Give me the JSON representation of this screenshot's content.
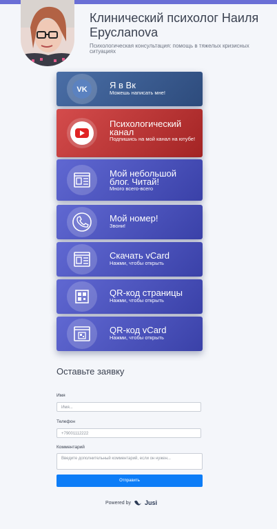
{
  "header": {
    "name": "Клинический психолог Наиля Еруслanova",
    "subtitle": "Психологическая консультация: помощь в тяжелых кризисных ситуациях"
  },
  "cards": [
    {
      "title": "Я в Вк",
      "subtitle": "Можешь написать мне!",
      "icon": "vk-icon",
      "color": "#3d5f95"
    },
    {
      "title": "Психологический канал",
      "subtitle": "Подпишись на мой канал на ютубе!",
      "icon": "youtube-icon",
      "color": "#c43a3a"
    },
    {
      "title": "Мой небольшой блог. Читай!",
      "subtitle": "Много всего-всего",
      "icon": "webpage-icon",
      "color": "#4b54c2"
    },
    {
      "title": "Мой номер!",
      "subtitle": "Звони!",
      "icon": "phone-icon",
      "color": "#4b54c2"
    },
    {
      "title": "Скачать vCard",
      "subtitle": "Нажми, чтобы открыть",
      "icon": "webpage-icon",
      "color": "#4b54c2"
    },
    {
      "title": "QR-код страницы",
      "subtitle": "Нажми, чтобы открыть",
      "icon": "qr-icon",
      "color": "#4b54c2"
    },
    {
      "title": "QR-код vCard",
      "subtitle": "Нажми, чтобы открыть",
      "icon": "qr-card-icon",
      "color": "#4b54c2"
    }
  ],
  "form": {
    "title": "Оставьте заявку",
    "name_label": "Имя",
    "name_placeholder": "Имя...",
    "phone_label": "Телефон",
    "phone_placeholder": "+79001112222",
    "comment_label": "Комментарий",
    "comment_placeholder": "Введите дополнительный комментарий, если он нужен...",
    "submit_label": "Отправить"
  },
  "footer": {
    "powered_by": "Powered by",
    "brand": "Jusi"
  }
}
